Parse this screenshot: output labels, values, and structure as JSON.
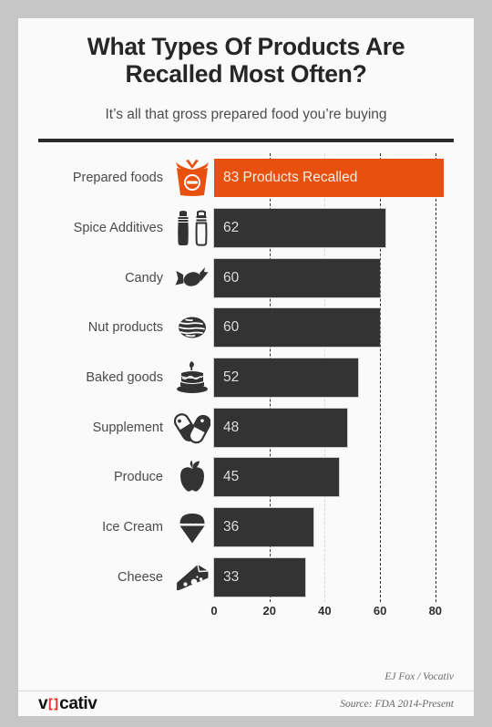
{
  "header": {
    "title": "What Types Of Products Are Recalled Most Often?",
    "subtitle": "It’s all that gross prepared food you’re buying"
  },
  "credit": "EJ Fox / Vocativ",
  "source": "Source: FDA 2014-Present",
  "logo": {
    "pre": "v",
    "post": "cativ",
    "accent": "#e8352b"
  },
  "colors": {
    "bar": "#333333",
    "highlight": "#e8500f",
    "card": "#fafafa",
    "page": "#c6c6c6",
    "rule": "#2b2b2b"
  },
  "chart_data": {
    "type": "bar",
    "orientation": "horizontal",
    "title": "What Types Of Products Are Recalled Most Often?",
    "subtitle": "It’s all that gross prepared food you’re buying",
    "xlabel": "",
    "ylabel": "",
    "xlim": [
      0,
      85
    ],
    "grid": true,
    "legend": false,
    "ticks": [
      0,
      20,
      40,
      60,
      80
    ],
    "categories": [
      "Prepared foods",
      "Spice Additives",
      "Candy",
      "Nut products",
      "Baked goods",
      "Supplement",
      "Produce",
      "Ice Cream",
      "Cheese"
    ],
    "values": [
      83,
      62,
      60,
      60,
      52,
      48,
      45,
      36,
      33
    ],
    "bar_labels": [
      "83 Products Recalled",
      "62",
      "60",
      "60",
      "52",
      "48",
      "45",
      "36",
      "33"
    ],
    "icons": [
      "takeout-box-icon",
      "salt-pepper-shakers-icon",
      "candy-icon",
      "walnut-icon",
      "cake-icon",
      "pills-icon",
      "apple-icon",
      "ice-cream-cone-icon",
      "cheese-wedge-icon"
    ],
    "highlight_index": 0
  }
}
